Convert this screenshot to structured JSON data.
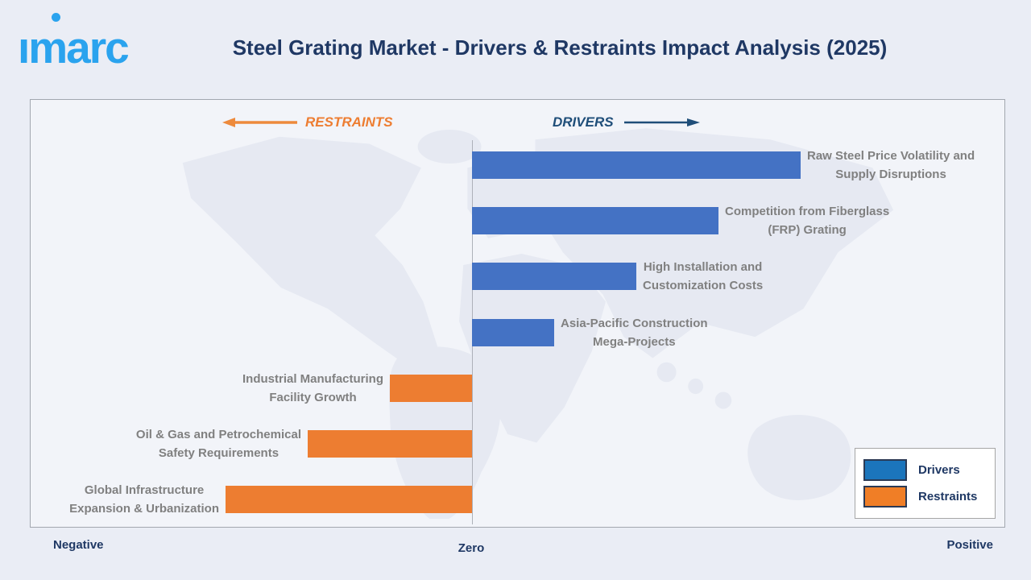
{
  "header": {
    "logo_word": "ımarc",
    "title": "Steel Grating Market - Drivers & Restraints Impact Analysis (2025)"
  },
  "direction_labels": {
    "restraints": "RESTRAINTS",
    "drivers": "DRIVERS"
  },
  "legend": {
    "items": [
      {
        "label": "Drivers",
        "color": "#1b75bc"
      },
      {
        "label": "Restraints",
        "color": "#f07e26"
      }
    ]
  },
  "axis": {
    "negative": "Negative",
    "zero": "Zero",
    "positive": "Positive"
  },
  "colors": {
    "driver_bar": "#4472c4",
    "restraint_bar": "#ed7d31",
    "title_navy": "#1f3864",
    "drivers_header": "#1f4e79",
    "restraints_header": "#ed7d31",
    "label_gray": "#808080",
    "logo_blue": "#2aa3ee"
  },
  "chart_data": {
    "type": "bar",
    "subtype": "diverging-tornado",
    "orientation": "horizontal",
    "title": "Steel Grating Market - Drivers & Restraints Impact Analysis (2025)",
    "xlabel_ticks": [
      "Negative",
      "Zero",
      "Positive"
    ],
    "value_note": "relative impact magnitude estimated from bar lengths; drivers positive, restraints negative",
    "xlim": [
      -4,
      5
    ],
    "grid": false,
    "legend_position": "bottom-right",
    "series": [
      {
        "name": "Drivers",
        "color": "#4472c4"
      },
      {
        "name": "Restraints",
        "color": "#ed7d31"
      }
    ],
    "items": [
      {
        "label_lines": [
          "Raw Steel Price Volatility and",
          "Supply Disruptions"
        ],
        "series": "Drivers",
        "value": 4
      },
      {
        "label_lines": [
          "Competition from Fiberglass",
          "(FRP) Grating"
        ],
        "series": "Drivers",
        "value": 3
      },
      {
        "label_lines": [
          "High Installation and",
          "Customization Costs"
        ],
        "series": "Drivers",
        "value": 2
      },
      {
        "label_lines": [
          "Asia-Pacific Construction",
          "Mega-Projects"
        ],
        "series": "Drivers",
        "value": 1
      },
      {
        "label_lines": [
          "Industrial Manufacturing",
          "Facility Growth"
        ],
        "series": "Restraints",
        "value": -1
      },
      {
        "label_lines": [
          "Oil & Gas and Petrochemical",
          "Safety Requirements"
        ],
        "series": "Restraints",
        "value": -2
      },
      {
        "label_lines": [
          "Global Infrastructure",
          "Expansion & Urbanization"
        ],
        "series": "Restraints",
        "value": -3
      }
    ]
  }
}
